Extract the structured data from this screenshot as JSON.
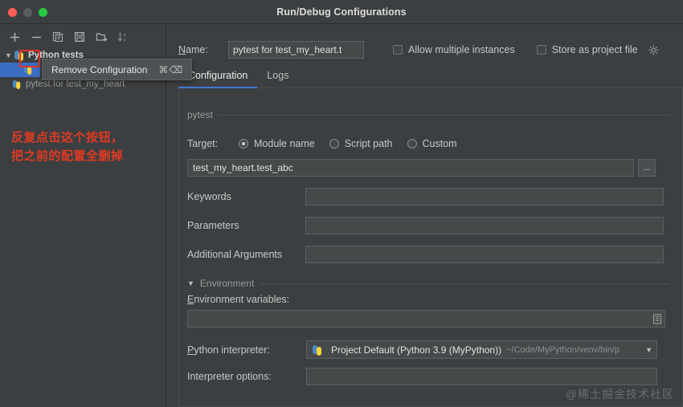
{
  "window": {
    "title": "Run/Debug Configurations",
    "traffic_lights": [
      "close-red",
      "minimize-gray",
      "maximize-green"
    ]
  },
  "left_panel": {
    "toolbar": [
      {
        "name": "add",
        "glyph": "+",
        "tooltip": "Add New Configuration"
      },
      {
        "name": "remove",
        "glyph": "−",
        "tooltip": "Remove Configuration",
        "highlighted": true
      },
      {
        "name": "copy",
        "glyph": "copy-icon",
        "tooltip": "Copy Configuration"
      },
      {
        "name": "save",
        "glyph": "save-icon",
        "tooltip": "Save Configuration"
      },
      {
        "name": "move-into-folder",
        "glyph": "folder-add-icon",
        "tooltip": "Move into new folder"
      },
      {
        "name": "sort",
        "glyph": "sort-alpha-icon",
        "tooltip": "Sort Configurations"
      }
    ],
    "tree": [
      {
        "label": "Python tests",
        "type": "group",
        "expanded": true,
        "icon": "python-tests-icon"
      },
      {
        "label": "",
        "type": "child",
        "selected": true,
        "icon": "python-test-icon"
      },
      {
        "label": "pytest for test_my_heart",
        "type": "child",
        "selected": false,
        "icon": "python-test-icon"
      }
    ],
    "tooltip": {
      "label": "Remove Configuration",
      "shortcut": "⌘⌫"
    },
    "annotation": {
      "line1": "反复点击这个按钮，",
      "line2": "把之前的配置全删掉",
      "color": "#e03a22"
    }
  },
  "right_panel": {
    "name_label": "Name:",
    "name_value": "pytest for test_my_heart.t",
    "allow_multiple_instances": {
      "label": "Allow multiple instances",
      "checked": false
    },
    "store_as_project_file": {
      "label": "Store as project file",
      "checked": false
    },
    "gear_icon": "gear-icon",
    "tabs": [
      {
        "label": "Configuration",
        "active": true
      },
      {
        "label": "Logs",
        "active": false
      }
    ],
    "section_pytest": "pytest",
    "target": {
      "label": "Target:",
      "options": [
        {
          "label": "Module name",
          "selected": true
        },
        {
          "label": "Script path",
          "selected": false
        },
        {
          "label": "Custom",
          "selected": false
        }
      ],
      "value": "test_my_heart.test_abc",
      "browse_button": "..."
    },
    "fields": [
      {
        "label": "Keywords",
        "value": "",
        "placeholder": ""
      },
      {
        "label": "Parameters",
        "value": "",
        "placeholder": ""
      },
      {
        "label": "Additional Arguments",
        "value": "",
        "placeholder": ""
      }
    ],
    "environment": {
      "section_label": "Environment",
      "expanded": true,
      "env_vars_label": "Environment variables:",
      "env_vars_value": "",
      "env_vars_icon": "edit-list-icon",
      "interpreter_label": "Python interpreter:",
      "interpreter_icon": "python-icon",
      "interpreter_value": "Project Default (Python 3.9 (MyPython))",
      "interpreter_path": "~/Code/MyPython/venv/bin/p",
      "interpreter_options_label": "Interpreter options:",
      "interpreter_options_value": ""
    }
  },
  "watermark": "@稀土掘金技术社区",
  "colors": {
    "background": "#3c3f41",
    "panel_border": "#2b2b2b",
    "accent_blue": "#3d7bd4",
    "selection_blue": "#3b6dc4",
    "annotation_red": "#e03a22",
    "field_bg": "#45494a",
    "field_border": "#5c6062",
    "text_primary": "#c7c7c7",
    "text_muted": "#9a9a9a"
  }
}
